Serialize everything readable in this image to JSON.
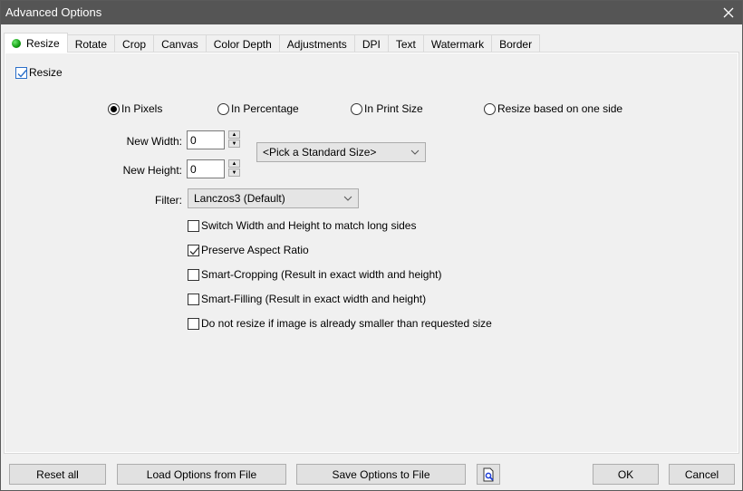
{
  "window": {
    "title": "Advanced Options"
  },
  "tabs": [
    {
      "label": "Resize",
      "active": true,
      "status_color": "#16a016"
    },
    {
      "label": "Rotate"
    },
    {
      "label": "Crop"
    },
    {
      "label": "Canvas"
    },
    {
      "label": "Color Depth"
    },
    {
      "label": "Adjustments"
    },
    {
      "label": "DPI"
    },
    {
      "label": "Text"
    },
    {
      "label": "Watermark"
    },
    {
      "label": "Border"
    }
  ],
  "resize": {
    "enable_label": "Resize",
    "enabled": true,
    "modes": [
      {
        "label": "In Pixels",
        "selected": true
      },
      {
        "label": "In Percentage",
        "selected": false
      },
      {
        "label": "In Print Size",
        "selected": false
      },
      {
        "label": "Resize based on one side",
        "selected": false
      }
    ],
    "width_label": "New Width:",
    "width_value": "0",
    "height_label": "New Height:",
    "height_value": "0",
    "standard_size": "<Pick a Standard Size>",
    "filter_label": "Filter:",
    "filter_value": "Lanczos3 (Default)",
    "options": [
      {
        "label": "Switch Width and Height to match long sides",
        "checked": false
      },
      {
        "label": "Preserve Aspect Ratio",
        "checked": true
      },
      {
        "label": "Smart-Cropping (Result in exact width and height)",
        "checked": false
      },
      {
        "label": "Smart-Filling (Result in exact width and height)",
        "checked": false
      },
      {
        "label": "Do not resize if image is already smaller than requested size",
        "checked": false
      }
    ]
  },
  "footer": {
    "reset": "Reset all",
    "load": "Load Options from File",
    "save": "Save Options to File",
    "ok": "OK",
    "cancel": "Cancel"
  }
}
